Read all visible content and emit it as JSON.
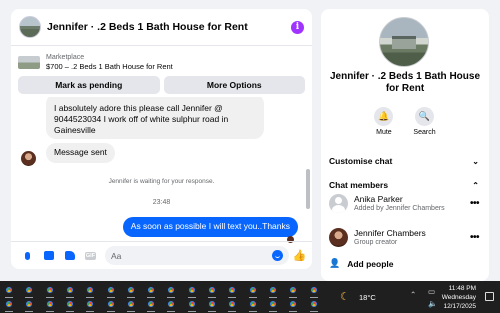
{
  "chat": {
    "title": "Jennifer · .2 Beds 1 Bath House for Rent",
    "listing": {
      "category": "Marketplace",
      "price_line": "$700 – .2 Beds 1 Bath House for Rent"
    },
    "buttons": {
      "mark_pending": "Mark as pending",
      "more_options": "More Options"
    },
    "messages": {
      "incoming_1": "I absolutely adore this please call Jennifer @ 9044523034 I work off of white sulphur road in Gainesville",
      "incoming_2": "Message sent",
      "waiting": "Jennifer is waiting for your response.",
      "time": "23:48",
      "outgoing_1": "As soon as possible I will text you..Thanks"
    },
    "composer": {
      "placeholder": "Aa",
      "icons": [
        "microphone-icon",
        "photo-icon",
        "sticker-icon",
        "gif-icon",
        "emoji-icon",
        "like-icon"
      ],
      "gif_label": "GIF"
    },
    "accent": "#0866ff"
  },
  "details": {
    "title": "Jennifer · .2 Beds 1 Bath House for Rent",
    "actions": [
      {
        "label": "Mute",
        "icon": "bell-icon"
      },
      {
        "label": "Search",
        "icon": "search-icon"
      }
    ],
    "sections": {
      "customise": "Customise chat",
      "members": "Chat members"
    },
    "members": [
      {
        "name": "Anika Parker",
        "sub": "Added by Jennifer Chambers"
      },
      {
        "name": "Jennifer Chambers",
        "sub": "Group creator"
      }
    ],
    "add_people": "Add people"
  },
  "taskbar": {
    "weather": "18°C",
    "time": "11:48 PM",
    "day": "Wednesday",
    "date": "12/17/2025"
  }
}
